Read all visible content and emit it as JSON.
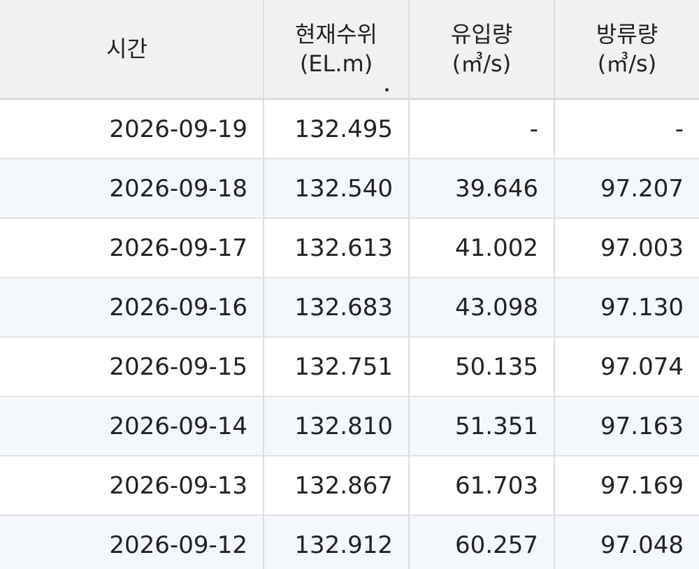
{
  "table": {
    "headers": {
      "time": "시간",
      "level_line1": "현재수위",
      "level_line2": "(EL.m)",
      "inflow_line1": "유입량",
      "inflow_line2": "(㎥/s)",
      "outflow_line1": "방류량",
      "outflow_line2": "(㎥/s)"
    },
    "rows": [
      {
        "time": "2026-09-19",
        "level": "132.495",
        "inflow": "-",
        "outflow": "-"
      },
      {
        "time": "2026-09-18",
        "level": "132.540",
        "inflow": "39.646",
        "outflow": "97.207"
      },
      {
        "time": "2026-09-17",
        "level": "132.613",
        "inflow": "41.002",
        "outflow": "97.003"
      },
      {
        "time": "2026-09-16",
        "level": "132.683",
        "inflow": "43.098",
        "outflow": "97.130"
      },
      {
        "time": "2026-09-15",
        "level": "132.751",
        "inflow": "50.135",
        "outflow": "97.074"
      },
      {
        "time": "2026-09-14",
        "level": "132.810",
        "inflow": "51.351",
        "outflow": "97.163"
      },
      {
        "time": "2026-09-13",
        "level": "132.867",
        "inflow": "61.703",
        "outflow": "97.169"
      },
      {
        "time": "2026-09-12",
        "level": "132.912",
        "inflow": "60.257",
        "outflow": "97.048"
      }
    ]
  }
}
